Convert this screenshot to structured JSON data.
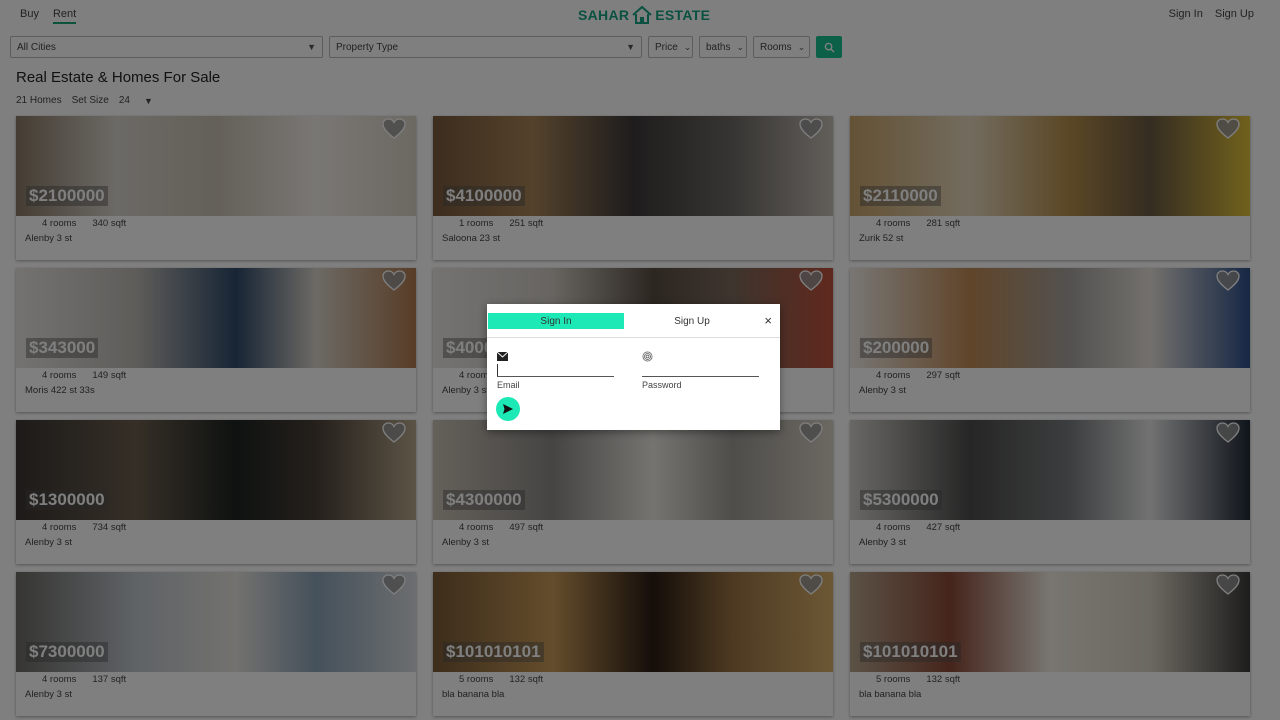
{
  "nav": {
    "buy": "Buy",
    "rent": "Rent",
    "sign_in": "Sign In",
    "sign_up": "Sign Up"
  },
  "logo": {
    "left": "SAHAR",
    "right": "ESTATE",
    "color": "#17a383"
  },
  "filters": {
    "city": "All Cities",
    "property_type": "Property Type",
    "price": "Price",
    "baths": "baths",
    "rooms": "Rooms"
  },
  "listing": {
    "title": "Real Estate & Homes For Sale",
    "count": "21 Homes",
    "set_size_label": "Set Size",
    "set_size_value": "24"
  },
  "cards": [
    {
      "price": "$2100000",
      "rooms": "4 rooms",
      "sqft": "340 sqft",
      "address": "Alenby 3 st"
    },
    {
      "price": "$4100000",
      "rooms": "1 rooms",
      "sqft": "251 sqft",
      "address": "Saloona 23 st"
    },
    {
      "price": "$2110000",
      "rooms": "4 rooms",
      "sqft": "281 sqft",
      "address": "Zurik 52 st"
    },
    {
      "price": "$343000",
      "rooms": "4 rooms",
      "sqft": "149 sqft",
      "address": "Moris 422 st 33s"
    },
    {
      "price": "$4000",
      "rooms": "4 rooms",
      "sqft": "",
      "address": "Alenby 3 st"
    },
    {
      "price": "$200000",
      "rooms": "4 rooms",
      "sqft": "297 sqft",
      "address": "Alenby 3 st"
    },
    {
      "price": "$1300000",
      "rooms": "4 rooms",
      "sqft": "734 sqft",
      "address": "Alenby 3 st"
    },
    {
      "price": "$4300000",
      "rooms": "4 rooms",
      "sqft": "497 sqft",
      "address": "Alenby 3 st"
    },
    {
      "price": "$5300000",
      "rooms": "4 rooms",
      "sqft": "427 sqft",
      "address": "Alenby 3 st"
    },
    {
      "price": "$7300000",
      "rooms": "4 rooms",
      "sqft": "137 sqft",
      "address": "Alenby 3 st"
    },
    {
      "price": "$101010101",
      "rooms": "5 rooms",
      "sqft": "132 sqft",
      "address": "bla banana bla"
    },
    {
      "price": "$101010101",
      "rooms": "5 rooms",
      "sqft": "132 sqft",
      "address": "bla banana bla"
    }
  ],
  "modal": {
    "tab_signin": "Sign In",
    "tab_signup": "Sign Up",
    "close": "×",
    "email_label": "Email",
    "password_label": "Password",
    "accent": "#1de9b6"
  },
  "colors": {
    "primary": "#17c08f",
    "overlay": "rgba(0,0,0,0.5)"
  }
}
